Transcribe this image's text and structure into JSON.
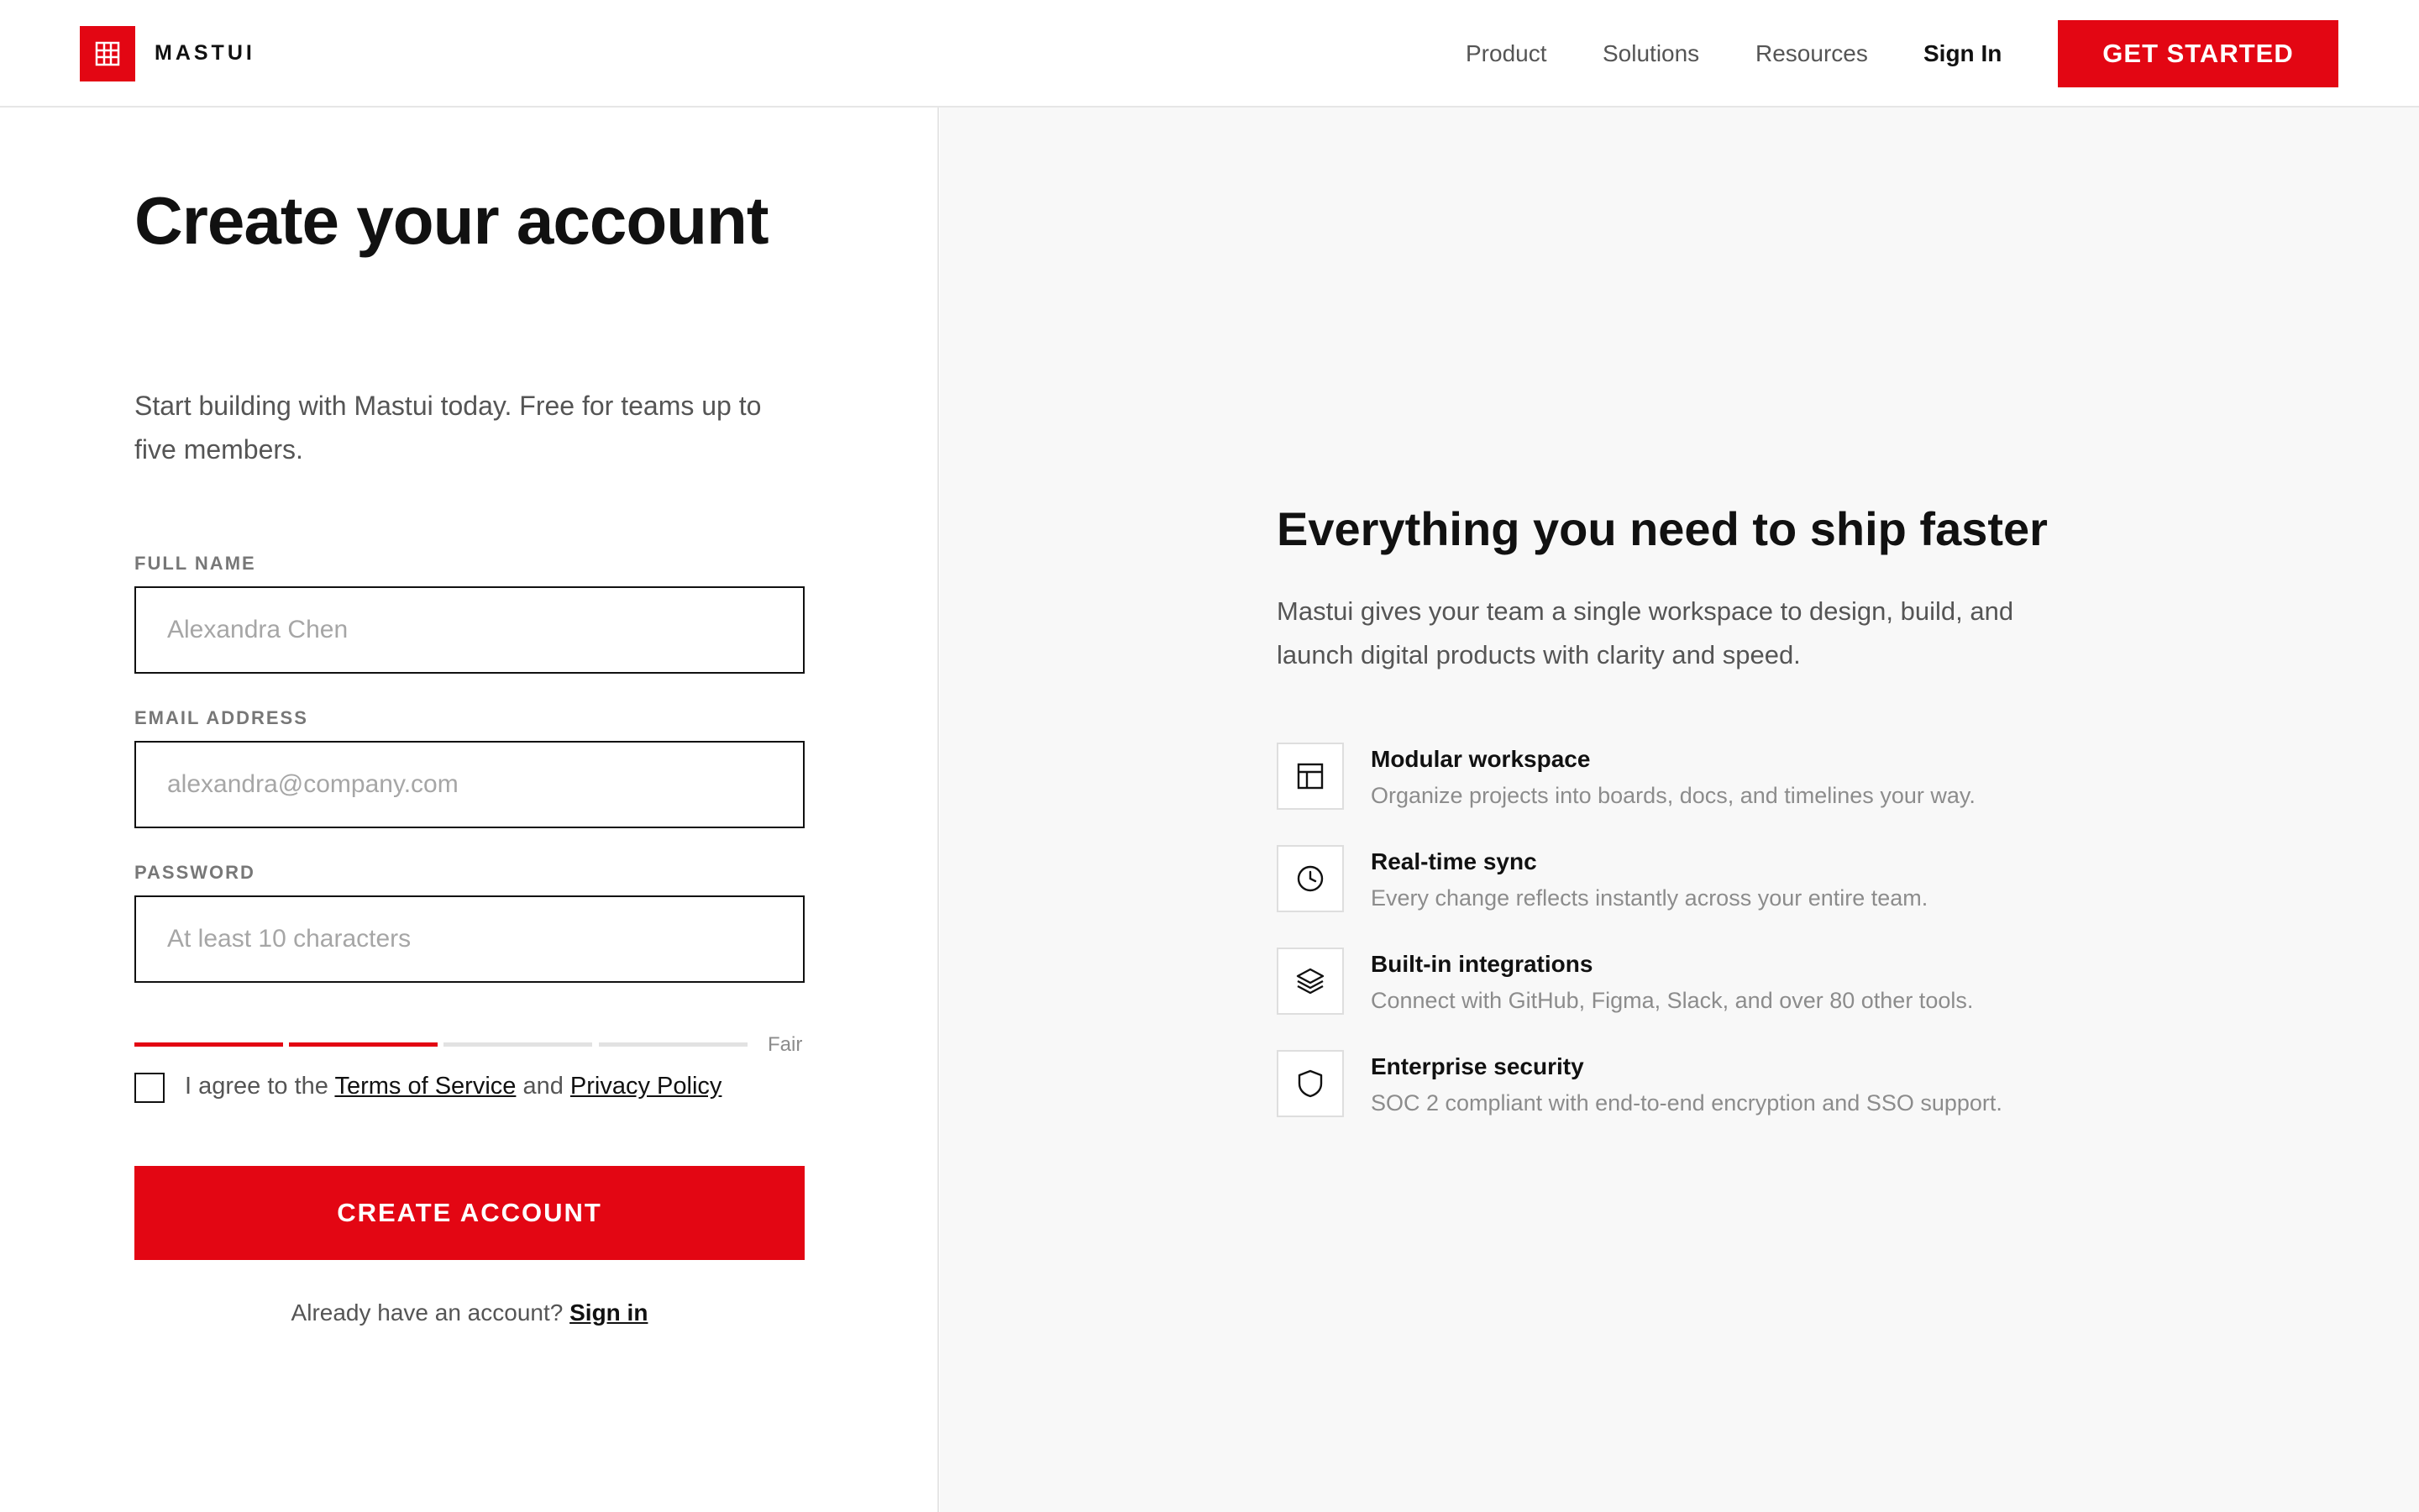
{
  "colors": {
    "accent": "#e30613",
    "text_primary": "#111111",
    "text_secondary": "#555555",
    "text_muted": "#8c8c8c",
    "right_panel_bg": "#f8f8f8"
  },
  "header": {
    "logo_icon": "grid-icon",
    "brand": "MASTUI",
    "nav": [
      "Product",
      "Solutions",
      "Resources"
    ],
    "sign_in": "Sign In",
    "cta": "GET STARTED"
  },
  "form": {
    "title": "Create your account",
    "subtitle": "Start building with Mastui today. Free for teams up to five members.",
    "full_name": {
      "label": "FULL NAME",
      "placeholder": "Alexandra Chen",
      "value": ""
    },
    "email": {
      "label": "EMAIL ADDRESS",
      "placeholder": "alexandra@company.com",
      "value": ""
    },
    "password": {
      "label": "PASSWORD",
      "placeholder": "At least 10 characters",
      "value": ""
    },
    "strength": {
      "filled_segments": 2,
      "total_segments": 4,
      "label": "Fair"
    },
    "agree": {
      "checked": false,
      "prefix": "I agree to the",
      "terms": "Terms of Service",
      "conjunction": "and",
      "privacy": "Privacy Policy"
    },
    "submit": "CREATE ACCOUNT",
    "signin_prompt": "Already have an account?",
    "signin_link": "Sign in"
  },
  "aside": {
    "title": "Everything you need to ship faster",
    "description": "Mastui gives your team a single workspace to design, build, and launch digital products with clarity and speed.",
    "features": [
      {
        "icon": "layout-icon",
        "title": "Modular workspace",
        "description": "Organize projects into boards, docs, and timelines your way."
      },
      {
        "icon": "clock-icon",
        "title": "Real-time sync",
        "description": "Every change reflects instantly across your entire team."
      },
      {
        "icon": "layers-icon",
        "title": "Built-in integrations",
        "description": "Connect with GitHub, Figma, Slack, and over 80 other tools."
      },
      {
        "icon": "shield-icon",
        "title": "Enterprise security",
        "description": "SOC 2 compliant with end-to-end encryption and SSO support."
      }
    ]
  }
}
